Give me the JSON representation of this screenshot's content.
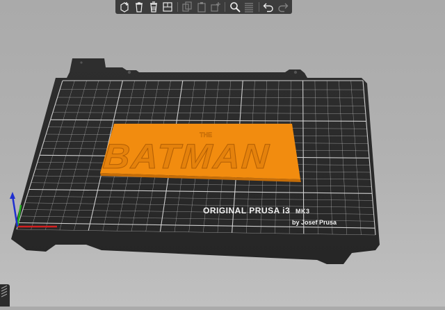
{
  "window": {
    "background": "#b0b0b0"
  },
  "toolbar": {
    "items": [
      {
        "name": "add-icon",
        "enabled": true
      },
      {
        "name": "delete-icon",
        "enabled": true
      },
      {
        "name": "delete-all-icon",
        "enabled": true
      },
      {
        "name": "arrange-icon",
        "enabled": true
      },
      {
        "name": "copy-icon",
        "enabled": false
      },
      {
        "name": "paste-icon",
        "enabled": false
      },
      {
        "name": "instance-add-icon",
        "enabled": false
      },
      {
        "name": "search-icon",
        "enabled": true
      },
      {
        "name": "layers-icon",
        "enabled": false
      },
      {
        "name": "undo-icon",
        "enabled": true
      },
      {
        "name": "redo-icon",
        "enabled": false
      }
    ]
  },
  "bed": {
    "brand_line1": "ORIGINAL PRUSA i3",
    "brand_model": "MK3",
    "brand_line2": "by Josef Prusa",
    "color": "#2b2b2b",
    "grid_color": "#d8d8d8"
  },
  "model": {
    "top_text": "THE",
    "main_text": "BATMAN",
    "color": "#f28c0f"
  },
  "axes": {
    "x_color": "#d42020",
    "y_color": "#1fb01f",
    "z_color": "#2030d0"
  }
}
